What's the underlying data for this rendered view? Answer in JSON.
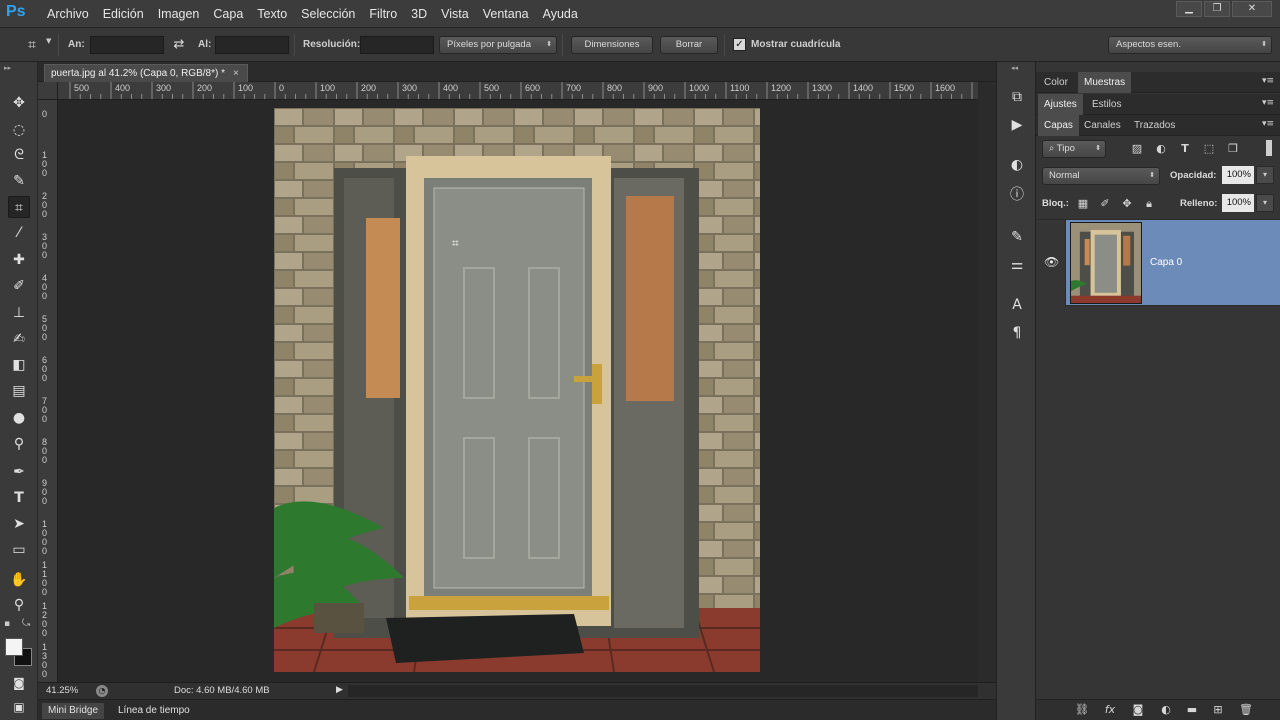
{
  "app": {
    "logo": "Ps"
  },
  "menu": [
    "Archivo",
    "Edición",
    "Imagen",
    "Capa",
    "Texto",
    "Selección",
    "Filtro",
    "3D",
    "Vista",
    "Ventana",
    "Ayuda"
  ],
  "window_controls": {
    "minimize": "▁",
    "restore": "❐",
    "close": "✕"
  },
  "options": {
    "width_label": "An:",
    "height_label": "Al:",
    "resolution_label": "Resolución:",
    "units_select": "Píxeles por pulgada",
    "dimensions_button": "Dimensiones",
    "clear_button": "Borrar",
    "grid_checkbox_label": "Mostrar cuadrícula",
    "grid_checked": true,
    "workspace_select": "Aspectos esen."
  },
  "document": {
    "tab_title": "puerta.jpg al 41.2% (Capa 0, RGB/8*) *",
    "tab_close": "×",
    "ruler_h_labels": [
      "500",
      "400",
      "300",
      "200",
      "100",
      "0",
      "100",
      "200",
      "300",
      "400",
      "500",
      "600",
      "700",
      "800",
      "900",
      "1000",
      "1100",
      "1200",
      "1300",
      "1400",
      "1500",
      "1600"
    ],
    "ruler_v_labels": [
      "0",
      "100",
      "200",
      "300",
      "400",
      "500",
      "600",
      "700",
      "800",
      "900",
      "1000",
      "1100",
      "1200",
      "1300"
    ]
  },
  "status": {
    "zoom": "41.25%",
    "doc_info": "Doc: 4.60 MB/4.60 MB"
  },
  "bottom_tabs": [
    "Mini Bridge",
    "Línea de tiempo"
  ],
  "panels": {
    "top_tabs": [
      "Color",
      "Muestras"
    ],
    "adjust_tabs": [
      "Ajustes",
      "Estilos"
    ],
    "layers_tabs": [
      "Capas",
      "Canales",
      "Trazados"
    ],
    "kind_filter": "Tipo",
    "blend_mode": "Normal",
    "opacity_label": "Opacidad:",
    "opacity_value": "100%",
    "lock_label": "Bloq.:",
    "fill_label": "Relleno:",
    "fill_value": "100%",
    "layer_name": "Capa 0"
  },
  "colors": {
    "accent": "#2fa3f3",
    "selected_layer": "#6d8bb8",
    "bg_dark": "#282828",
    "panel": "#353535"
  }
}
